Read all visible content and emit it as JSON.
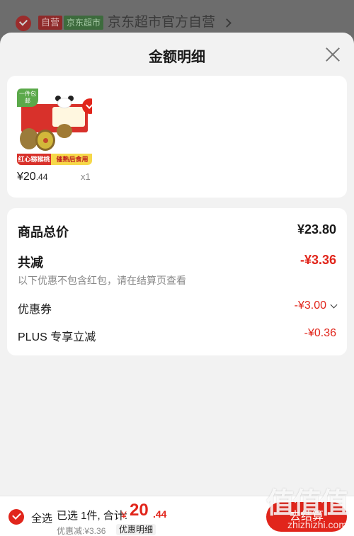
{
  "background": {
    "tag_self": "自营",
    "tag_jd": "京东超市",
    "shop_title": "京东超市官方自营"
  },
  "sheet": {
    "title": "金额明细",
    "close_icon": "close-icon"
  },
  "product": {
    "image": {
      "corner_tag": "一件包邮",
      "banner_left": "红心猕猴桃",
      "banner_right": "催熟后食用"
    },
    "price_symbol": "¥",
    "price_int": "20",
    "price_dec": ".44",
    "quantity": "x1",
    "selected": true
  },
  "summary": {
    "total_label": "商品总价",
    "total_value": "¥23.80",
    "reduce_label": "共减",
    "reduce_value": "-¥3.36",
    "reduce_note": "以下优惠不包含红包，请在结算页查看",
    "coupon_label": "优惠券",
    "coupon_value": "-¥3.00",
    "plus_label": "PLUS 专享立减",
    "plus_value": "-¥0.36"
  },
  "bottom": {
    "all_label": "全选",
    "selected_text": "已选 1件, 合计:",
    "total_currency": "¥",
    "total_int": "20",
    "total_dec": ".44",
    "discount_text": "优惠减:¥3.36",
    "detail_link": "优惠明细",
    "checkout": "去结算"
  },
  "watermark": {
    "big": "值值值",
    "small": "zhizhizhi.com"
  },
  "colors": {
    "accent": "#e1251b",
    "sheet_bg": "#f2f2f2"
  }
}
